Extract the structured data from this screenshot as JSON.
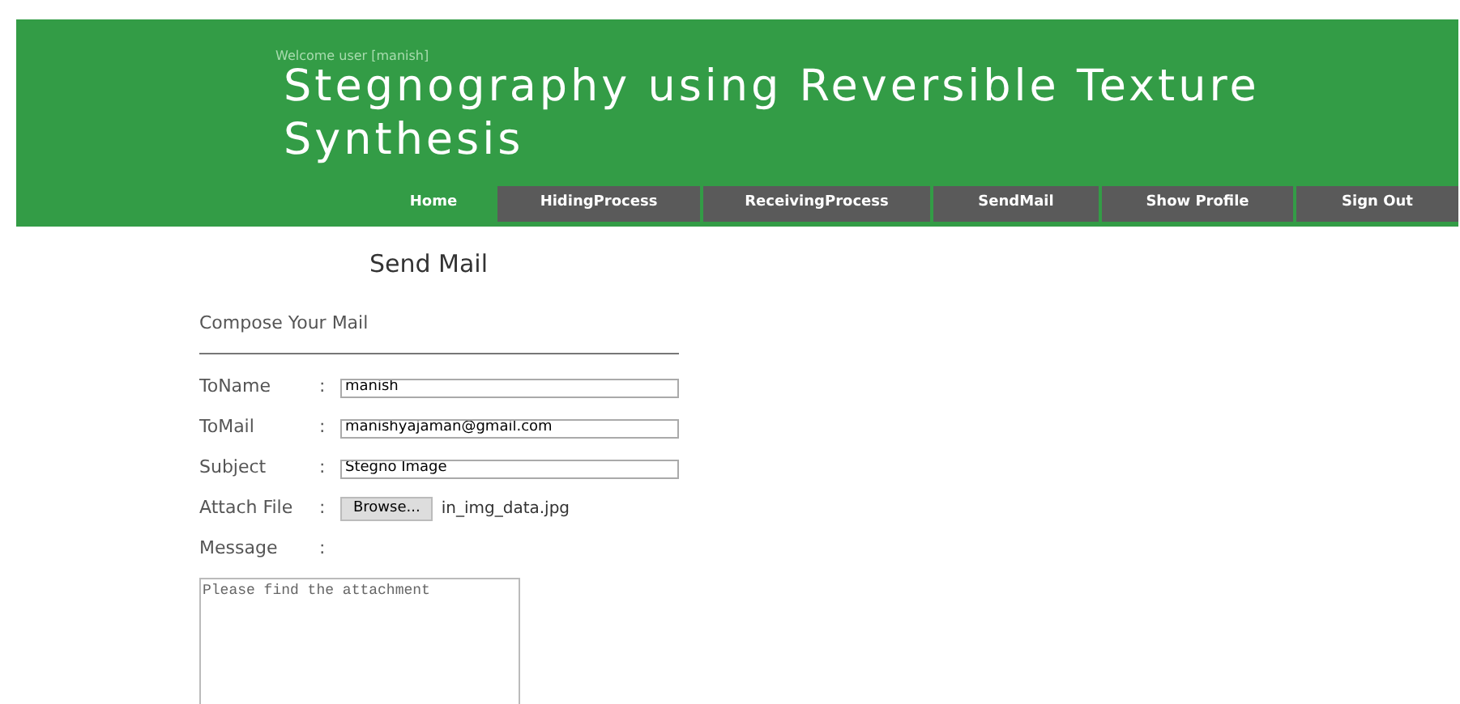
{
  "header": {
    "welcome": "Welcome user [manish]",
    "title": "Stegnography using Reversible Texture Synthesis"
  },
  "nav": [
    {
      "label": "Home",
      "selected": true
    },
    {
      "label": "HidingProcess",
      "selected": false
    },
    {
      "label": "ReceivingProcess",
      "selected": false
    },
    {
      "label": "SendMail",
      "selected": false
    },
    {
      "label": "Show Profile",
      "selected": false
    },
    {
      "label": "Sign Out",
      "selected": false
    }
  ],
  "page_title": "Send Mail",
  "form": {
    "heading": "Compose Your Mail",
    "fields": [
      {
        "kind": "text",
        "label": "ToName",
        "separator": ":",
        "value": "manish"
      },
      {
        "kind": "text",
        "label": "ToMail",
        "separator": ":",
        "value": "manishyajaman@gmail.com"
      },
      {
        "kind": "text",
        "label": "Subject",
        "separator": ":",
        "value": "Stegno Image"
      },
      {
        "kind": "file",
        "label": "Attach File",
        "separator": ":",
        "button": "Browse...",
        "file_name": "in_img_data.jpg"
      },
      {
        "kind": "label",
        "label": "Message",
        "separator": ":"
      }
    ],
    "message": "Please find the attachment"
  }
}
